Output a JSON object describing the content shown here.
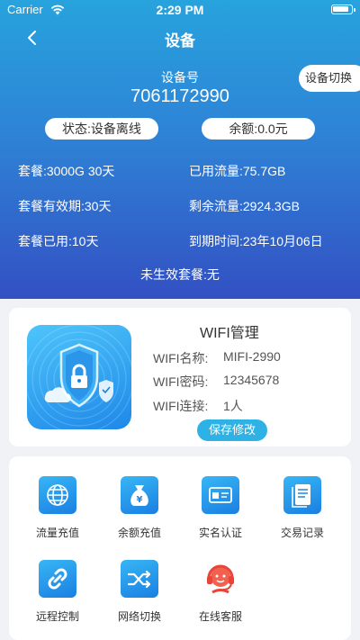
{
  "status_bar": {
    "carrier": "Carrier",
    "time": "2:29 PM"
  },
  "nav": {
    "title": "设备",
    "switch_label": "设备切换"
  },
  "device": {
    "number_label": "设备号",
    "number": "7061172990",
    "status": "状态:设备离线",
    "balance": "余额:0.0元"
  },
  "info": {
    "plan": "套餐:3000G 30天",
    "used_traffic": "已用流量:75.7GB",
    "validity": "套餐有效期:30天",
    "remaining_traffic": "剩余流量:2924.3GB",
    "used_days": "套餐已用:10天",
    "expire_time": "到期时间:23年10月06日",
    "pending_plan": "未生效套餐:无"
  },
  "wifi": {
    "title": "WIFI管理",
    "name_label": "WIFI名称:",
    "name_value": "MIFI-2990",
    "password_label": "WIFI密码:",
    "password_value": "12345678",
    "connections_label": "WIFI连接:",
    "connections_value": "1人",
    "save_label": "保存修改",
    "image_icon": "shield-lock-icon"
  },
  "menu": [
    {
      "label": "流量充值",
      "icon": "globe-icon"
    },
    {
      "label": "余额充值",
      "icon": "money-bag-icon"
    },
    {
      "label": "实名认证",
      "icon": "id-card-icon"
    },
    {
      "label": "交易记录",
      "icon": "document-icon"
    },
    {
      "label": "远程控制",
      "icon": "link-icon"
    },
    {
      "label": "网络切换",
      "icon": "shuffle-icon"
    },
    {
      "label": "在线客服",
      "icon": "headset-icon"
    }
  ],
  "colors": {
    "header_top": "#27a3dd",
    "header_bottom": "#3350c3",
    "accent": "#2eb2e6"
  }
}
